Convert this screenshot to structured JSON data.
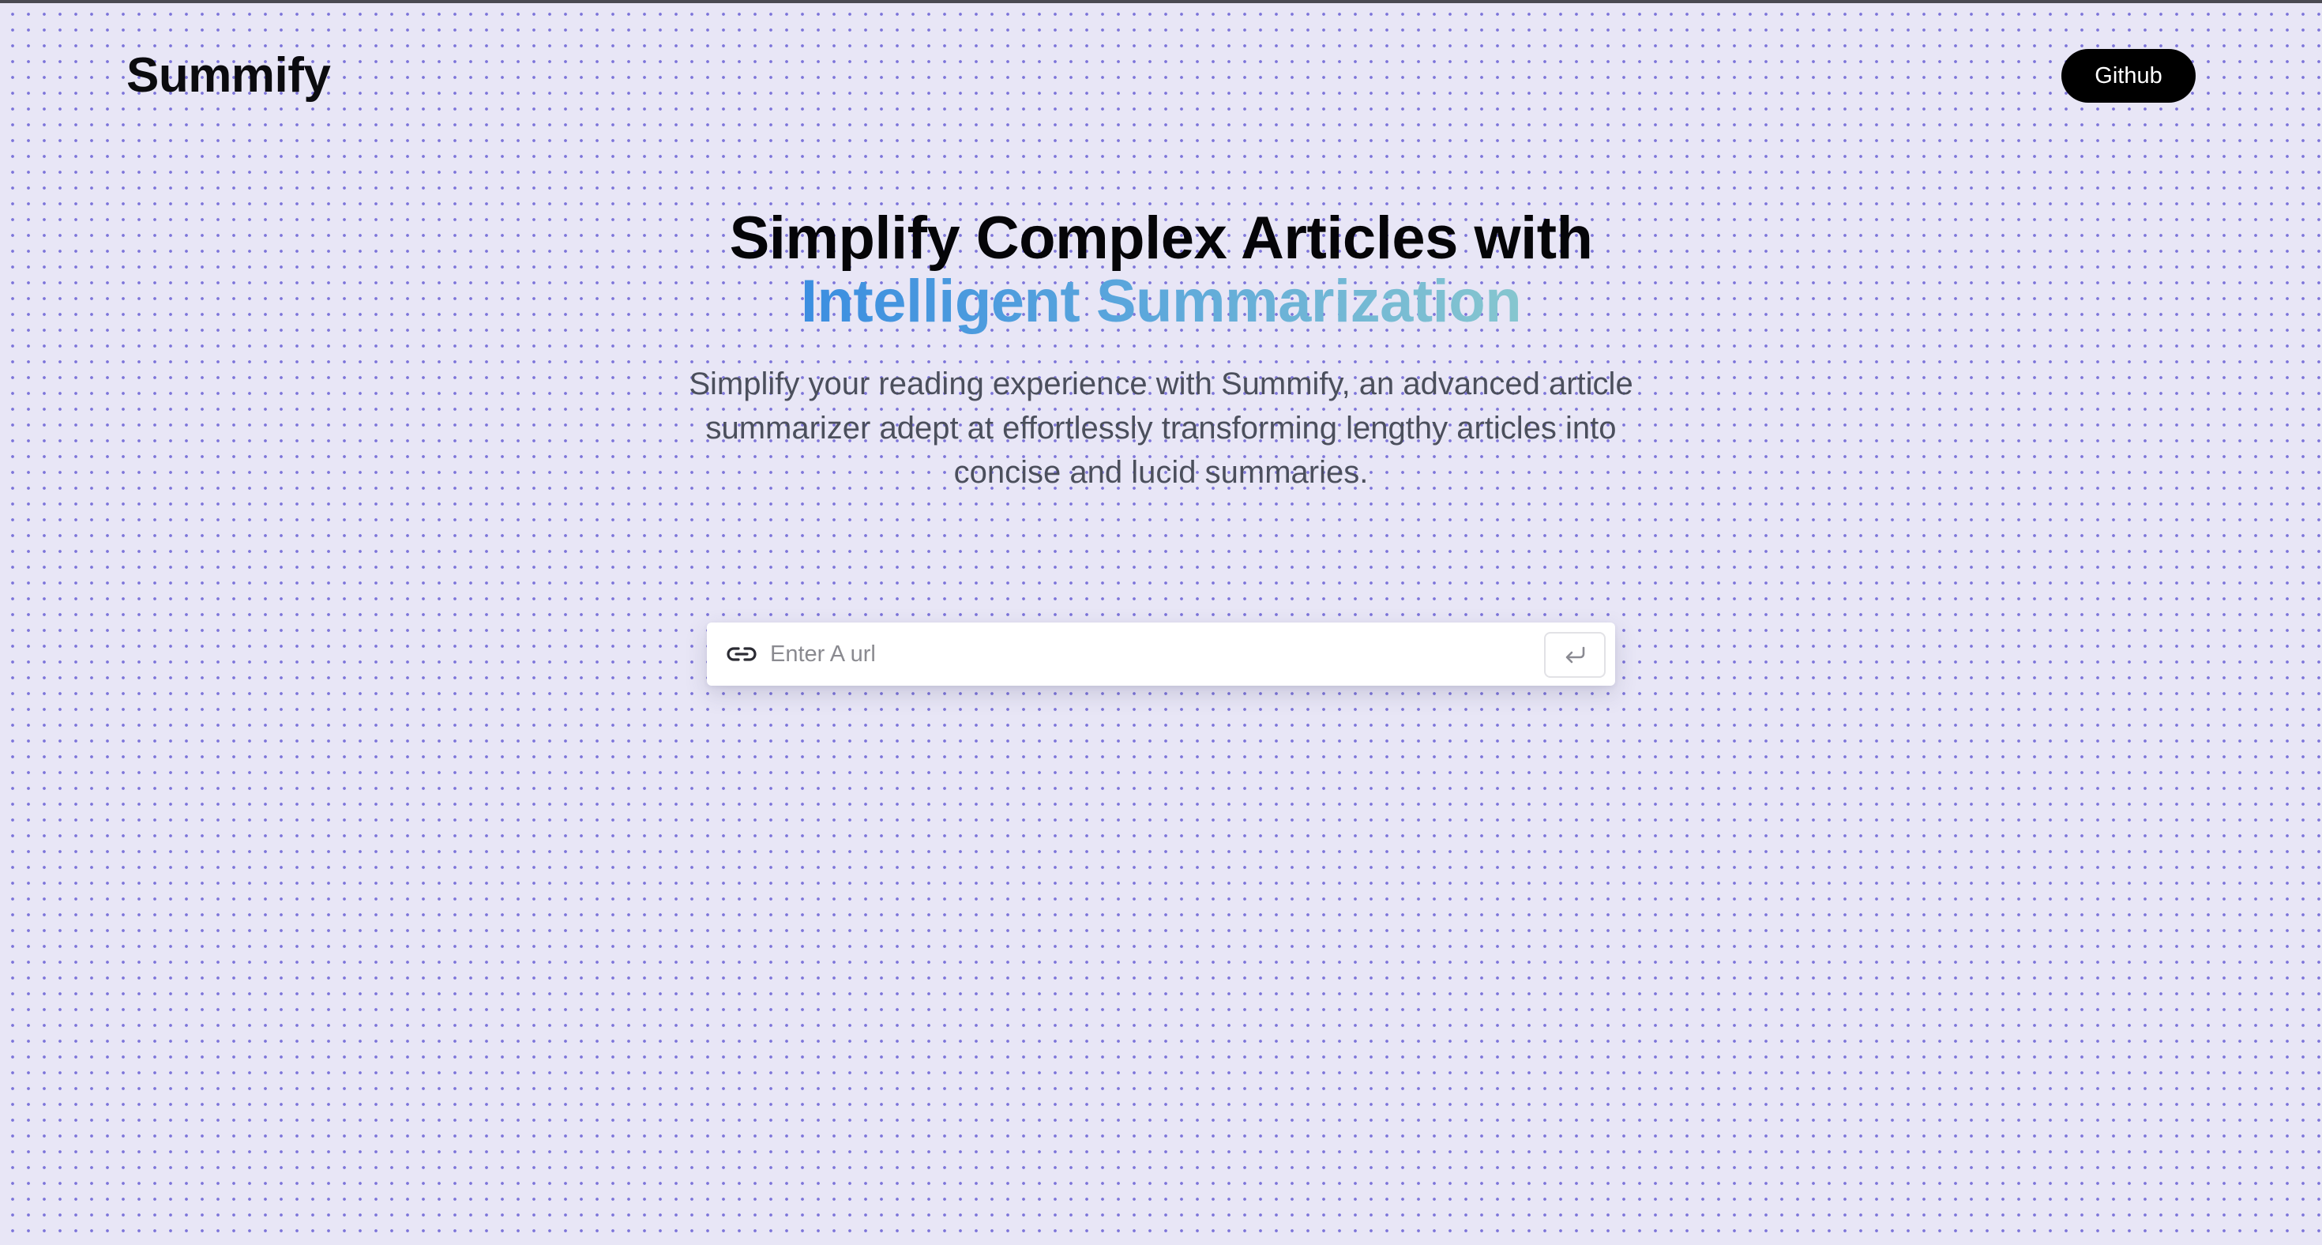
{
  "header": {
    "logo": "Summify",
    "github_label": "Github"
  },
  "hero": {
    "title_line1": "Simplify Complex Articles with",
    "title_line2": "Intelligent Summarization",
    "subtitle": "Simplify your reading experience with Summify, an advanced article summarizer adept at effortlessly transforming lengthy articles into concise and lucid summaries."
  },
  "search": {
    "placeholder": "Enter A url",
    "value": "",
    "link_icon": "link-icon",
    "submit_icon": "enter-return-icon"
  },
  "colors": {
    "background": "#e8e6f6",
    "dot": "#6860d4",
    "accent_gradient_start": "#3b8ee0",
    "accent_gradient_end": "#86c6cf",
    "button": "#000000"
  }
}
